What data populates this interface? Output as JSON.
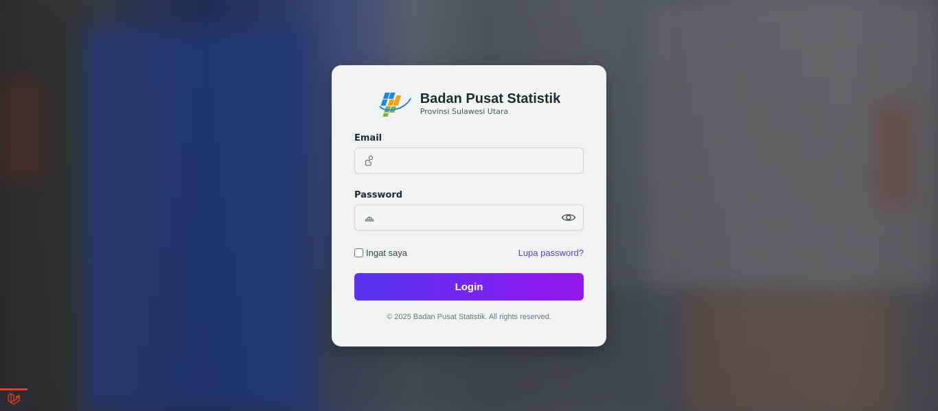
{
  "brand": {
    "title": "Badan Pusat Statistik",
    "subtitle": "Provinsi Sulawesi Utara",
    "logo_icon": "bps-logo"
  },
  "form": {
    "email_label": "Email",
    "email_value": "",
    "email_icon": "user-icon",
    "password_label": "Password",
    "password_value": "",
    "password_icon": "lock-icon",
    "toggle_icon": "eye-icon",
    "remember_label": "Ingat saya",
    "remember_checked": false,
    "forgot_label": "Lupa password?",
    "submit_label": "Login"
  },
  "footer": {
    "copyright": "© 2025 Badan Pusat Statistik. All rights reserved."
  },
  "colors": {
    "accent_start": "#5634f2",
    "accent_end": "#9616f0",
    "link": "#5b3fd6",
    "laravel": "#ef3b2d"
  },
  "debugbar": {
    "icon": "laravel-icon"
  }
}
